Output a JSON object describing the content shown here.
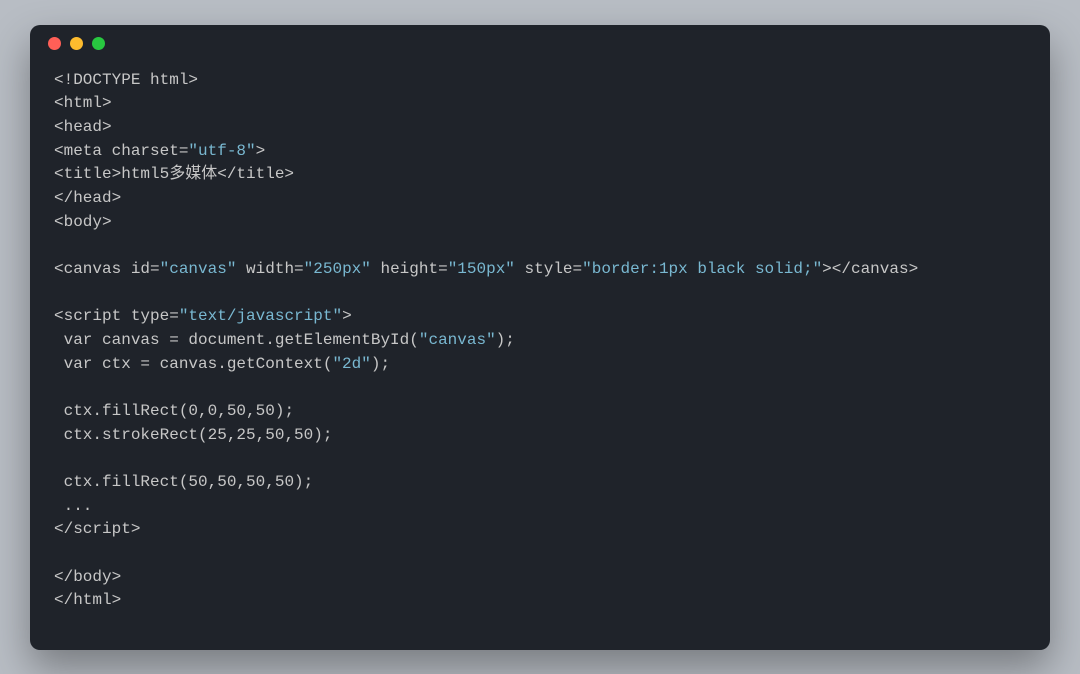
{
  "window": {
    "traffic_lights": [
      "close",
      "minimize",
      "zoom"
    ]
  },
  "code": {
    "lines": [
      [
        {
          "c": "p",
          "t": "<!DOCTYPE html>"
        }
      ],
      [
        {
          "c": "p",
          "t": "<html>"
        }
      ],
      [
        {
          "c": "p",
          "t": "<head>"
        }
      ],
      [
        {
          "c": "p",
          "t": "<meta charset="
        },
        {
          "c": "s",
          "t": "\"utf-8\""
        },
        {
          "c": "p",
          "t": ">"
        }
      ],
      [
        {
          "c": "p",
          "t": "<title>html5多媒体</title>"
        }
      ],
      [
        {
          "c": "p",
          "t": "</head>"
        }
      ],
      [
        {
          "c": "p",
          "t": "<body>"
        }
      ],
      [
        {
          "c": "p",
          "t": ""
        }
      ],
      [
        {
          "c": "p",
          "t": "<canvas id="
        },
        {
          "c": "s",
          "t": "\"canvas\""
        },
        {
          "c": "p",
          "t": " width="
        },
        {
          "c": "s",
          "t": "\"250px\""
        },
        {
          "c": "p",
          "t": " height="
        },
        {
          "c": "s",
          "t": "\"150px\""
        },
        {
          "c": "p",
          "t": " style="
        },
        {
          "c": "s",
          "t": "\"border:1px black solid;\""
        },
        {
          "c": "p",
          "t": "></canvas>"
        }
      ],
      [
        {
          "c": "p",
          "t": ""
        }
      ],
      [
        {
          "c": "p",
          "t": "<script type="
        },
        {
          "c": "s",
          "t": "\"text/javascript\""
        },
        {
          "c": "p",
          "t": ">"
        }
      ],
      [
        {
          "c": "p",
          "t": " var canvas = document.getElementById("
        },
        {
          "c": "s",
          "t": "\"canvas\""
        },
        {
          "c": "p",
          "t": ");"
        }
      ],
      [
        {
          "c": "p",
          "t": " var ctx = canvas.getContext("
        },
        {
          "c": "s",
          "t": "\"2d\""
        },
        {
          "c": "p",
          "t": ");"
        }
      ],
      [
        {
          "c": "p",
          "t": ""
        }
      ],
      [
        {
          "c": "p",
          "t": " ctx.fillRect(0,0,50,50);"
        }
      ],
      [
        {
          "c": "p",
          "t": " ctx.strokeRect(25,25,50,50);"
        }
      ],
      [
        {
          "c": "p",
          "t": ""
        }
      ],
      [
        {
          "c": "p",
          "t": " ctx.fillRect(50,50,50,50);"
        }
      ],
      [
        {
          "c": "p",
          "t": " ..."
        }
      ],
      [
        {
          "c": "p",
          "t": "</scr"
        },
        {
          "c": "p",
          "t": "ipt>"
        }
      ],
      [
        {
          "c": "p",
          "t": ""
        }
      ],
      [
        {
          "c": "p",
          "t": "</body>"
        }
      ],
      [
        {
          "c": "p",
          "t": "</html>"
        }
      ]
    ]
  }
}
